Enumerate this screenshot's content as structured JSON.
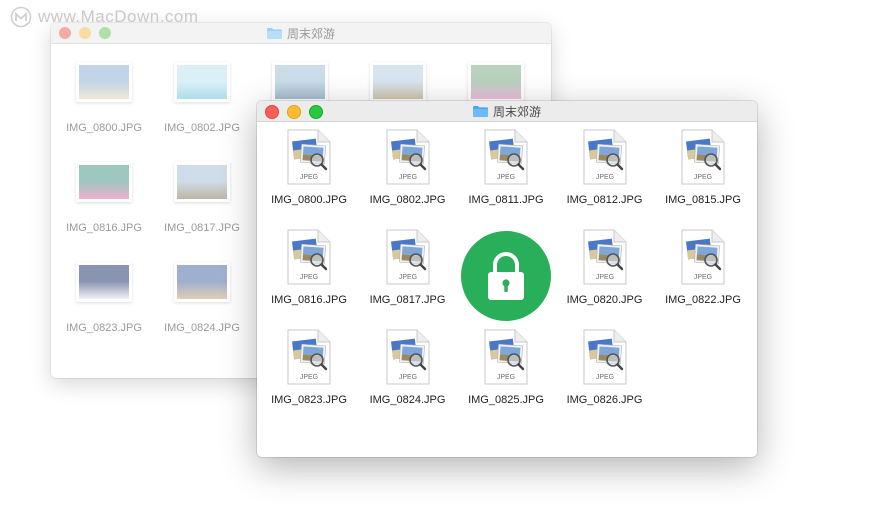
{
  "watermark": {
    "text": "www.MacDown.com"
  },
  "back_window": {
    "title": "周末郊游",
    "files": [
      {
        "name": "IMG_0800.JPG",
        "thumb_colors": [
          "#8fb2d6",
          "#e8d7b8"
        ]
      },
      {
        "name": "IMG_0802.JPG",
        "thumb_colors": [
          "#bfe2f2",
          "#6cc4d8"
        ]
      },
      {
        "name": "",
        "thumb_colors": [
          "#9fc2d8",
          "#5f8aa8"
        ]
      },
      {
        "name": "",
        "thumb_colors": [
          "#b9d0e4",
          "#a79a6e"
        ]
      },
      {
        "name": "",
        "thumb_colors": [
          "#7fae8a",
          "#e58ac0"
        ]
      },
      {
        "name": "IMG_0816.JPG",
        "thumb_colors": [
          "#4f9a8c",
          "#e46fa8"
        ]
      },
      {
        "name": "IMG_0817.JPG",
        "thumb_colors": [
          "#a8c0d8",
          "#8a7a58"
        ]
      },
      {
        "name": "IMG_0823.JPG",
        "thumb_colors": [
          "#2a3d72",
          "#e8e8f2"
        ]
      },
      {
        "name": "IMG_0824.JPG",
        "thumb_colors": [
          "#4f6fa8",
          "#c9a77a"
        ]
      }
    ]
  },
  "front_window": {
    "title": "周末郊游",
    "doc_type": "JPEG",
    "files": [
      "IMG_0800.JPG",
      "IMG_0802.JPG",
      "IMG_0811.JPG",
      "IMG_0812.JPG",
      "IMG_0815.JPG",
      "IMG_0816.JPG",
      "IMG_0817.JPG",
      "IMG_0820.JPG",
      "IMG_0822.JPG",
      "IMG_0823.JPG",
      "IMG_0824.JPG",
      "IMG_0825.JPG",
      "IMG_0826.JPG"
    ]
  },
  "lock_badge": {
    "icon": "lock-icon",
    "color": "#29ae59"
  }
}
